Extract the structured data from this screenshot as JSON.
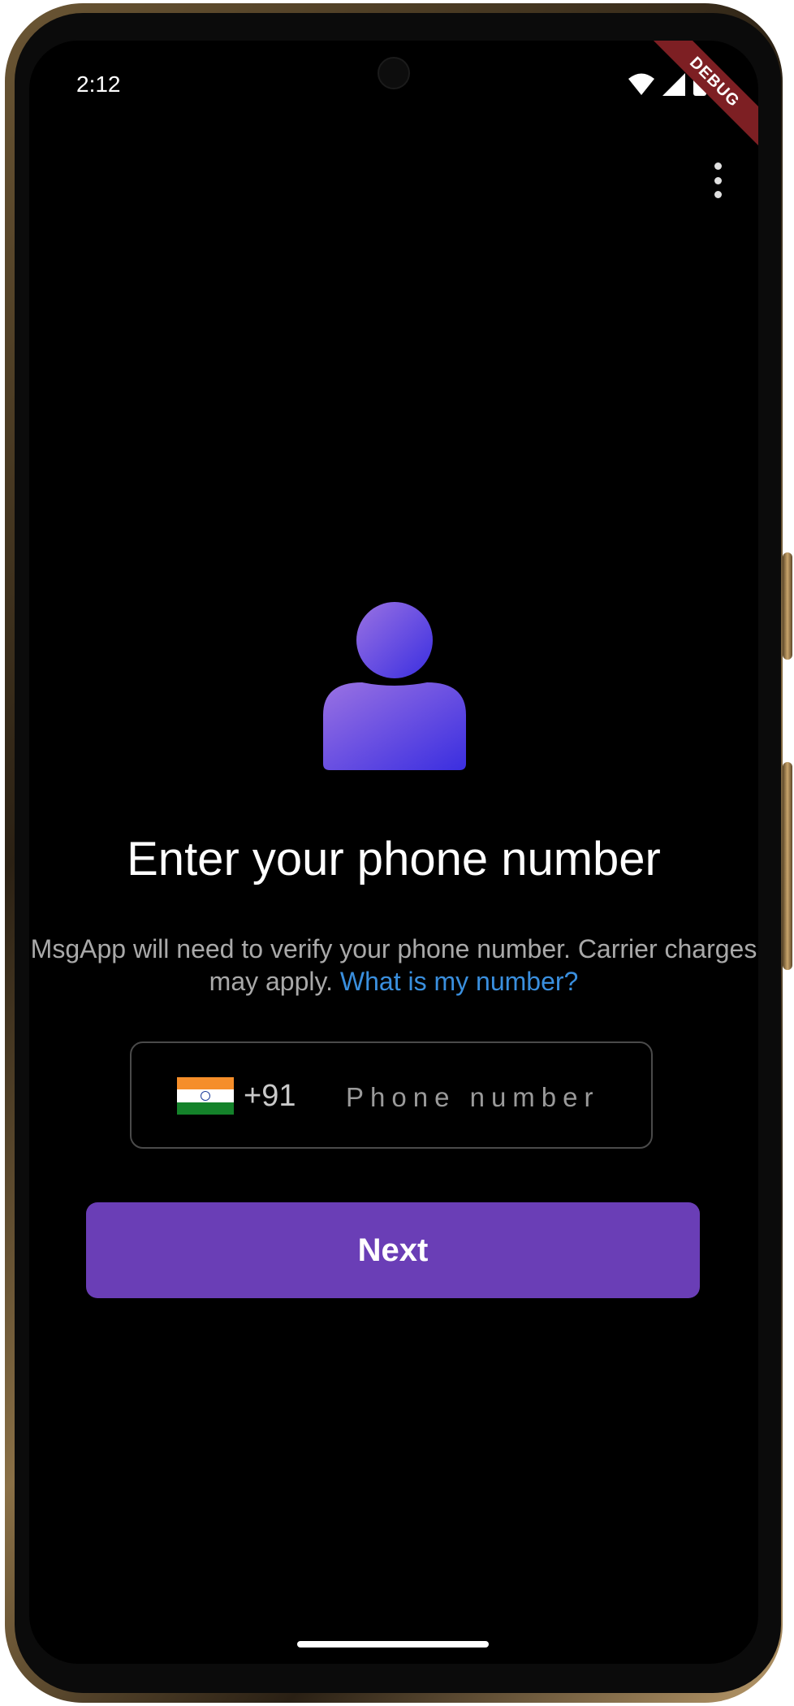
{
  "status_bar": {
    "time": "2:12",
    "icons": [
      "wifi-icon",
      "signal-icon",
      "battery-icon"
    ]
  },
  "debug_banner": "DEBUG",
  "toolbar": {
    "menu_icon": "more-vert-icon"
  },
  "main": {
    "avatar_icon": "person-icon",
    "title": "Enter your phone number",
    "description": "MsgApp will need to verify your phone number. Carrier charges may apply.",
    "help_link": "What is my number?",
    "phone_field": {
      "country_flag": "india-flag-icon",
      "country_code": "+91",
      "placeholder": "Phone number",
      "value": ""
    },
    "next_button": "Next"
  },
  "colors": {
    "background": "#000000",
    "accent": "#6a3eb6",
    "link": "#3a8fde",
    "avatar_gradient_start": "#9a72e3",
    "avatar_gradient_end": "#3a2ee0",
    "debug_ribbon": "#7d1f23"
  }
}
